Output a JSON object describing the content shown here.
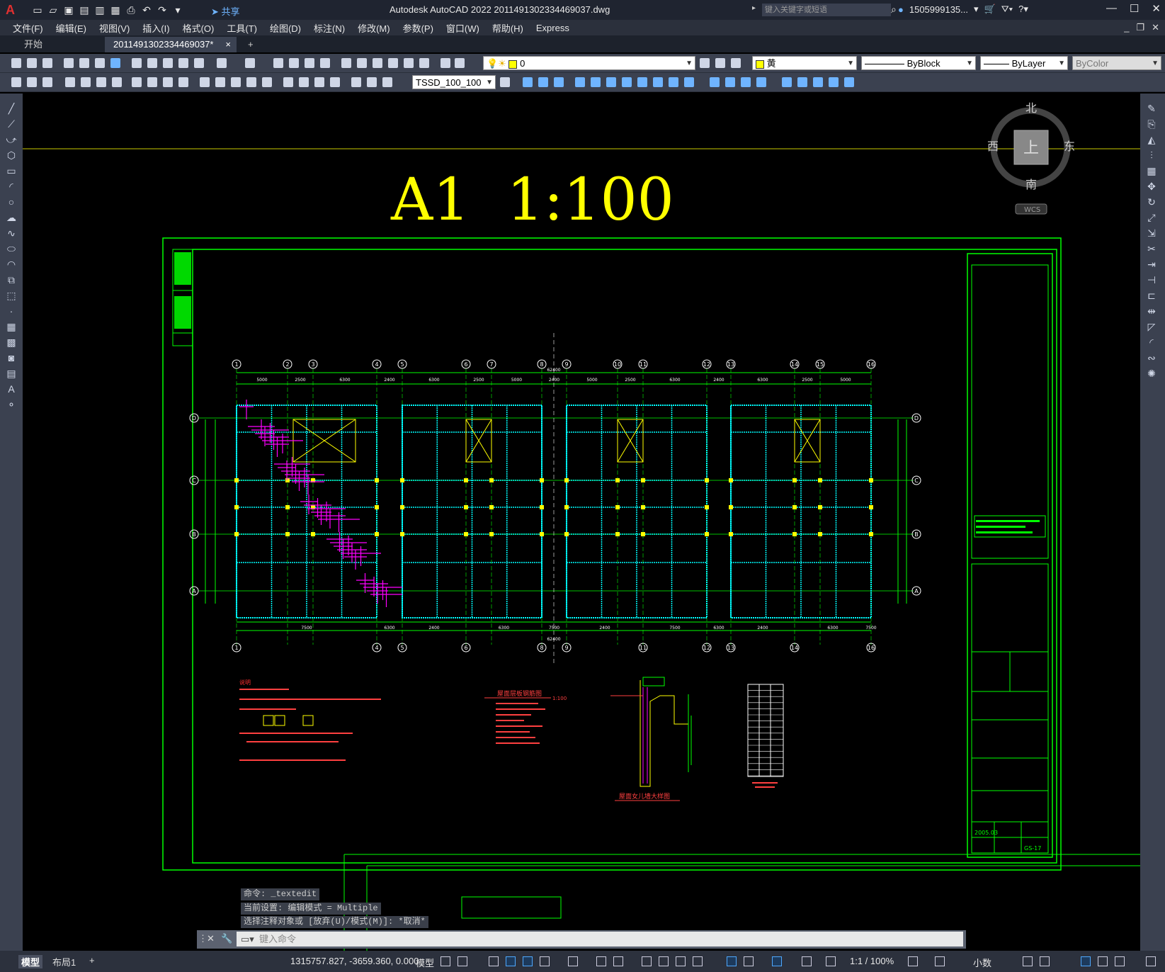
{
  "titlebar": {
    "app_title": "Autodesk AutoCAD 2022    2011491302334469037.dwg",
    "share_label": "共享",
    "search_placeholder": "键入关键字或短语",
    "user_name": "1505999135..."
  },
  "menu": [
    "文件(F)",
    "编辑(E)",
    "视图(V)",
    "插入(I)",
    "格式(O)",
    "工具(T)",
    "绘图(D)",
    "标注(N)",
    "修改(M)",
    "参数(P)",
    "窗口(W)",
    "帮助(H)",
    "Express"
  ],
  "tabs": {
    "start": "开始",
    "file": "2011491302334469037*",
    "close": "×",
    "add": "+"
  },
  "toolbar": {
    "layer_value": "0",
    "color_value": "黄",
    "linetype_value": "ByBlock",
    "lineweight_value": "ByLayer",
    "plotstyle_value": "ByColor",
    "dimstyle_value": "TSSD_100_100"
  },
  "viewcube": {
    "north": "北",
    "south": "南",
    "east": "东",
    "west": "西",
    "top": "上",
    "wcs": "WCS"
  },
  "drawing": {
    "title": "A1  1:100",
    "grid_cols_top": [
      "1",
      "2",
      "3",
      "4",
      "5",
      "6",
      "7",
      "8",
      "9",
      "10",
      "11",
      "12",
      "13",
      "14",
      "15",
      "16"
    ],
    "grid_cols_bottom": [
      "1",
      "4",
      "5",
      "6",
      "8",
      "9",
      "11",
      "12",
      "13",
      "14",
      "16"
    ],
    "grid_rows": [
      "D",
      "C",
      "B",
      "A"
    ],
    "dims_top": [
      "5000",
      "2500",
      "6300",
      "2400",
      "6300",
      "2500",
      "5000",
      "2400",
      "5000",
      "2500",
      "6300",
      "2400",
      "6300",
      "2500",
      "5000"
    ],
    "dims_bottom": [
      "7500",
      "6300",
      "2400",
      "6300",
      "7500",
      "2400",
      "7500",
      "6300",
      "2400",
      "6300",
      "7500"
    ],
    "total_dim": "62400",
    "section_title_1": "屋面层板钢筋图",
    "section_scale_1": "1:100",
    "section_title_2": "屋面女儿墙大样图",
    "notes_heading": "说明",
    "titleblock_date": "2005.03",
    "titleblock_sheet": "GS-17"
  },
  "command": {
    "line1": "命令: _textedit",
    "line2": "当前设置: 编辑模式 = Multiple",
    "line3": "选择注释对象或 [放弃(U)/模式(M)]: *取消*",
    "input_placeholder": "键入命令"
  },
  "status": {
    "tab_model": "模型",
    "tab_layout": "布局1",
    "tab_add": "+",
    "coords": "1315757.827, -3659.360, 0.000",
    "space": "模型",
    "scale": "1:1 / 100%",
    "units": "小数"
  }
}
